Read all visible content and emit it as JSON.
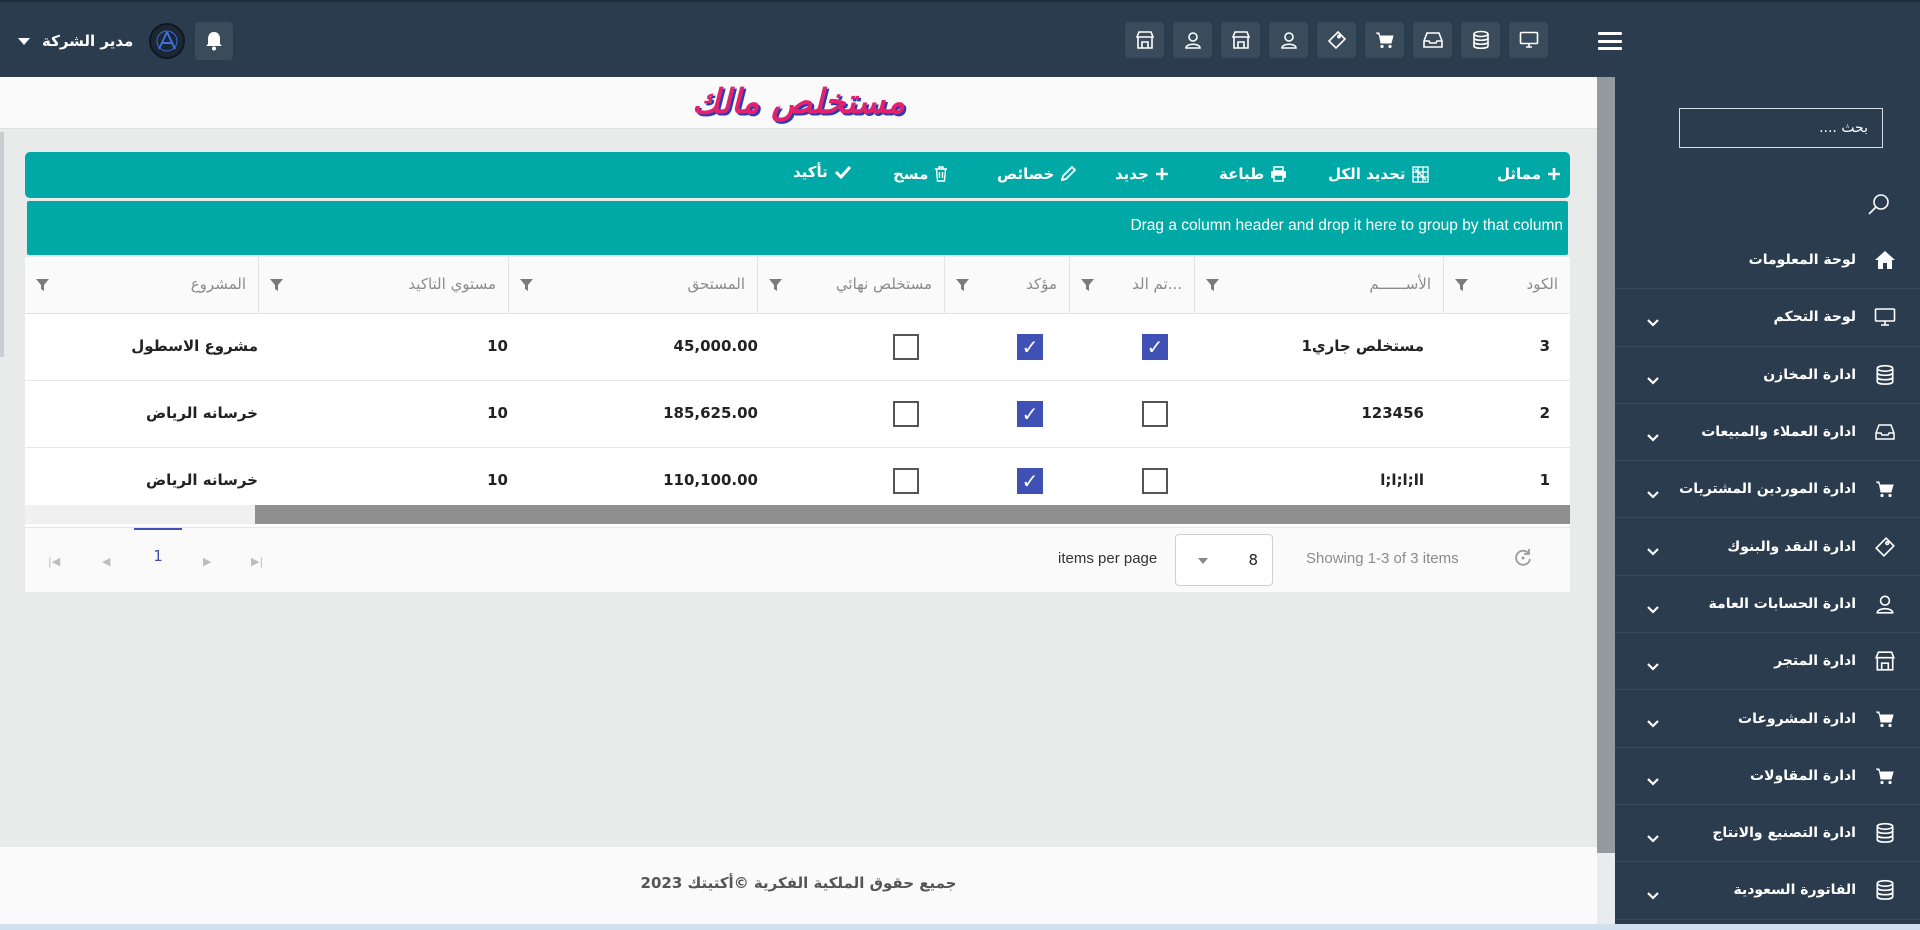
{
  "header": {
    "user_name": "مدير الشركة",
    "toolbar_icons": [
      "monitor-icon",
      "database-icon",
      "inbox-icon",
      "cart-icon",
      "ticket-icon",
      "user-icon",
      "store-icon",
      "user-icon",
      "store-icon"
    ]
  },
  "sidebar": {
    "search_placeholder": "بحث ....",
    "items": [
      {
        "label": "لوحة المعلومات",
        "icon": "home-icon",
        "has_submenu": false
      },
      {
        "label": "لوحة التحكم",
        "icon": "monitor-icon",
        "has_submenu": true
      },
      {
        "label": "ادارة المخازن",
        "icon": "database-icon",
        "has_submenu": true
      },
      {
        "label": "ادارة العملاء والمبيعات",
        "icon": "inbox-icon",
        "has_submenu": true
      },
      {
        "label": "ادارة الموردين المشتريات",
        "icon": "cart-icon",
        "has_submenu": true
      },
      {
        "label": "ادارة النقد والبنوك",
        "icon": "ticket-icon",
        "has_submenu": true
      },
      {
        "label": "ادارة الحسابات العامة",
        "icon": "user-icon",
        "has_submenu": true
      },
      {
        "label": "ادارة المتجر",
        "icon": "store-icon",
        "has_submenu": true
      },
      {
        "label": "ادارة المشروعات",
        "icon": "cart-icon",
        "has_submenu": true
      },
      {
        "label": "ادارة المقاولات",
        "icon": "cart-icon",
        "has_submenu": true
      },
      {
        "label": "ادارة التصنيع والانتاج",
        "icon": "database-icon",
        "has_submenu": true
      },
      {
        "label": "الفاتورة السعودية",
        "icon": "database-icon",
        "has_submenu": true
      }
    ]
  },
  "page": {
    "title": "مستخلص مالك"
  },
  "toolbar": {
    "similar": "مماثل",
    "select_all": "تحديد الكل",
    "print": "طباعة",
    "new": "جديد",
    "properties": "خصائص",
    "delete": "مسح",
    "confirm": "تأكيد"
  },
  "grid": {
    "group_hint": "Drag a column header and drop it here to group by that column",
    "columns": {
      "code": "الكود",
      "name": "الأســــــم",
      "done": "تم الد...",
      "confirmed": "مؤكد",
      "final": "مستخلص نهائي",
      "due": "المستحق",
      "confirm_level": "مستوي التاكيد",
      "project": "المشروع"
    },
    "rows": [
      {
        "code": "3",
        "name": "مستخلص جاري1",
        "done": true,
        "confirmed": true,
        "final": false,
        "due": "45,000.00",
        "confirm_level": "10",
        "project": "مشروع الاسطول"
      },
      {
        "code": "2",
        "name": "123456",
        "done": false,
        "confirmed": true,
        "final": false,
        "due": "185,625.00",
        "confirm_level": "10",
        "project": "خرسانه الرياض"
      },
      {
        "code": "1",
        "name": "l;l;l;ll",
        "done": false,
        "confirmed": true,
        "final": false,
        "due": "110,100.00",
        "confirm_level": "10",
        "project": "خرسانه الرياض"
      }
    ],
    "pager": {
      "current_page": "1",
      "page_size": "8",
      "page_size_label": "items per page",
      "showing": "Showing 1-3 of 3 items"
    }
  },
  "footer": {
    "copyright": "جميع حقوق الملكية الفكرية ©أكتيتك 2023"
  },
  "colors": {
    "header_bg": "#2b3c4e",
    "accent_teal": "#00a9a5",
    "checkbox_blue": "#3f51b5",
    "title_pink": "#e2226c"
  }
}
